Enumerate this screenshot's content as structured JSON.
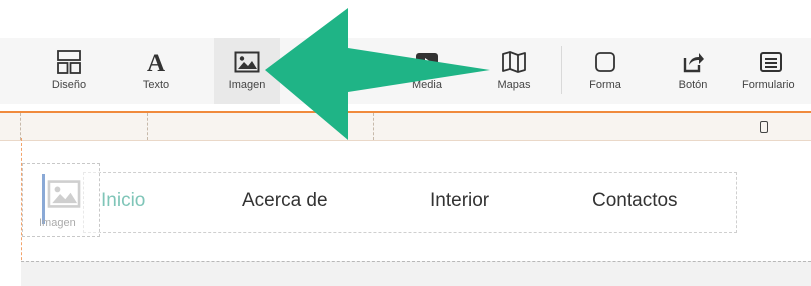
{
  "toolbar": {
    "items": [
      {
        "label": "Diseño",
        "icon": "layout-icon"
      },
      {
        "label": "Texto",
        "icon": "text-icon"
      },
      {
        "label": "Imagen",
        "icon": "image-icon"
      },
      {
        "label": "Media",
        "icon": "media-icon"
      },
      {
        "label": "Mapas",
        "icon": "map-icon"
      },
      {
        "label": "Forma",
        "icon": "shape-icon"
      },
      {
        "label": "Botón",
        "icon": "button-icon"
      },
      {
        "label": "Formulario",
        "icon": "form-icon"
      }
    ]
  },
  "nav": {
    "items": [
      "Inicio",
      "Acerca de",
      "Interior",
      "Contactos"
    ],
    "active_color": "#7fc5b8"
  },
  "drag_ghost": {
    "label": "Imagen",
    "icon": "image-icon"
  },
  "colors": {
    "arrow": "#1fb486",
    "accent": "#f08a3c"
  }
}
